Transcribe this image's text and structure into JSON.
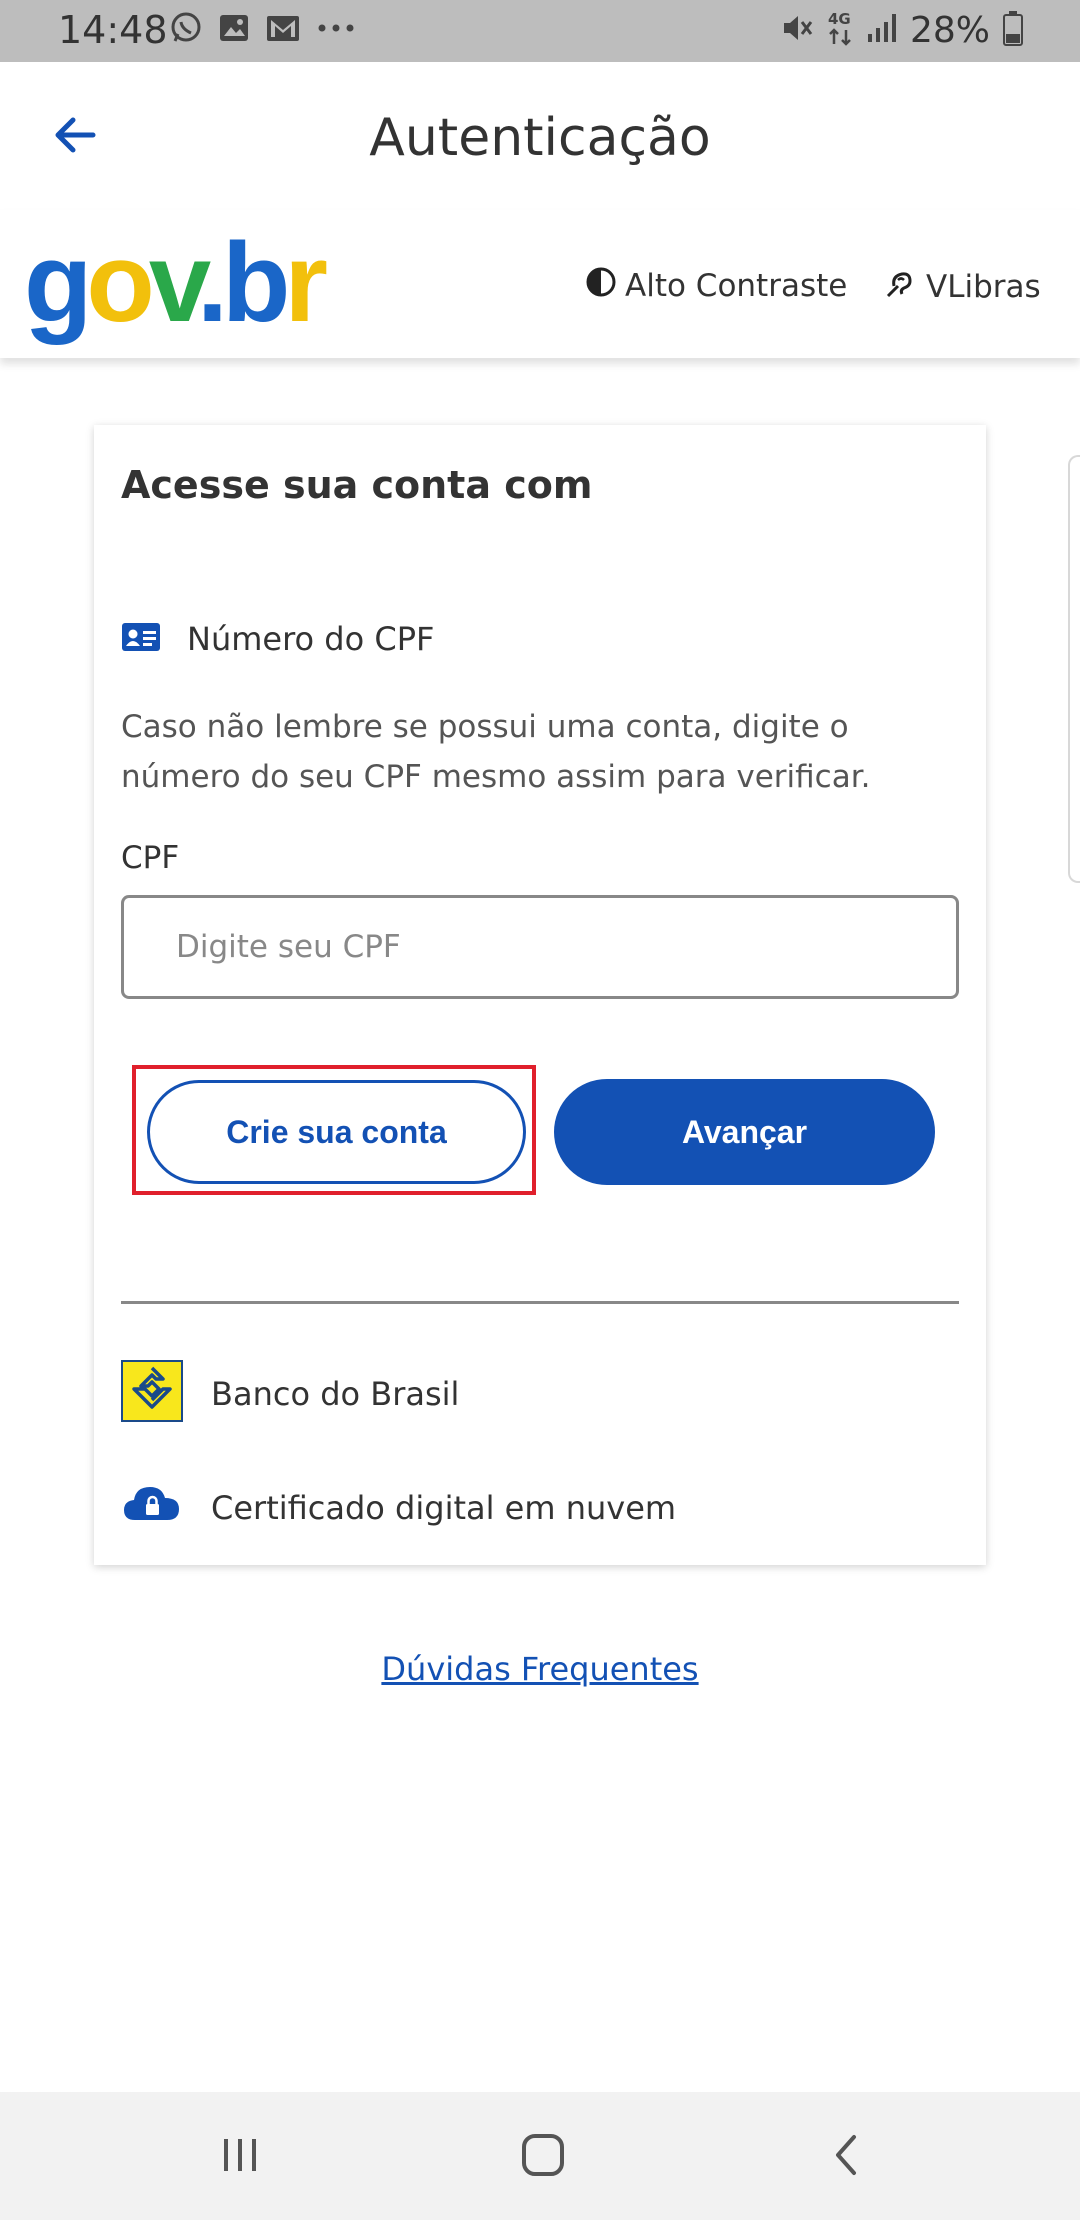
{
  "status_bar": {
    "time": "14:48",
    "left_icons": [
      "whatsapp-icon",
      "gallery-icon",
      "gmail-icon",
      "more-icon"
    ],
    "right_icons": [
      "mute-icon",
      "4g-icon",
      "signal-icon",
      "battery-icon"
    ],
    "network": "4G",
    "battery": "28%"
  },
  "app_bar": {
    "title": "Autenticação",
    "back_icon": "arrow-left-icon"
  },
  "header": {
    "logo": {
      "g": "g",
      "o": "o",
      "v": "v",
      "dot": ".",
      "b": "b",
      "r": "r"
    },
    "contrast_label": "Alto Contraste",
    "vlibras_label": "VLibras"
  },
  "card": {
    "title": "Acesse sua conta com",
    "cpf_method_label": "Número do CPF",
    "hint": "Caso não lembre se possui uma conta, digite o número do seu CPF mesmo assim para verificar.",
    "cpf_label": "CPF",
    "cpf_placeholder": "Digite seu CPF",
    "cpf_value": "",
    "create_account_label": "Crie sua conta",
    "next_label": "Avançar",
    "alternatives": [
      {
        "label": "Banco do Brasil",
        "icon": "banco-do-brasil-icon"
      },
      {
        "label": "Certificado digital em nuvem",
        "icon": "cloud-lock-icon"
      }
    ]
  },
  "faq_label": "Dúvidas Frequentes",
  "colors": {
    "primary": "#1351b4",
    "highlight": "#e0202c",
    "gov_blue": "#1a66c8",
    "gov_yellow": "#f2c00c",
    "gov_green": "#2aa84a"
  },
  "nav_bar": {
    "icons": [
      "recents-icon",
      "home-icon",
      "back-icon"
    ]
  }
}
